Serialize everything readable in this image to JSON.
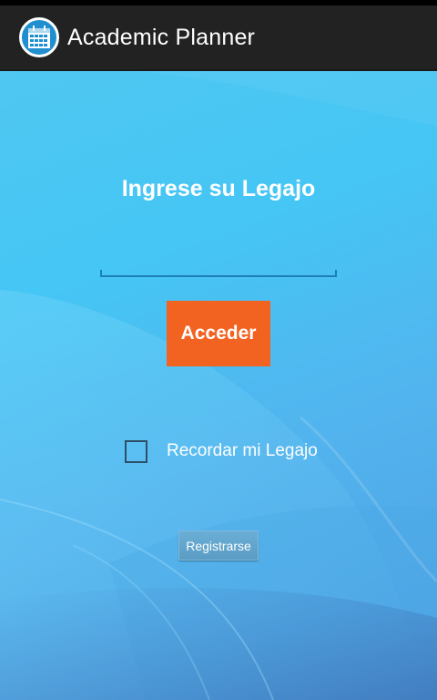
{
  "app": {
    "title": "Academic Planner",
    "icon": "calendar-icon"
  },
  "login": {
    "heading": "Ingrese su Legajo",
    "legajo_value": "",
    "submit_label": "Acceder",
    "remember_label": "Recordar mi Legajo",
    "remember_checked": false,
    "register_label": "Registrarse"
  },
  "colors": {
    "action_bar": "#222222",
    "accent": "#f26322",
    "background": "#45c6f4",
    "input_underline": "#1d7fb8"
  }
}
